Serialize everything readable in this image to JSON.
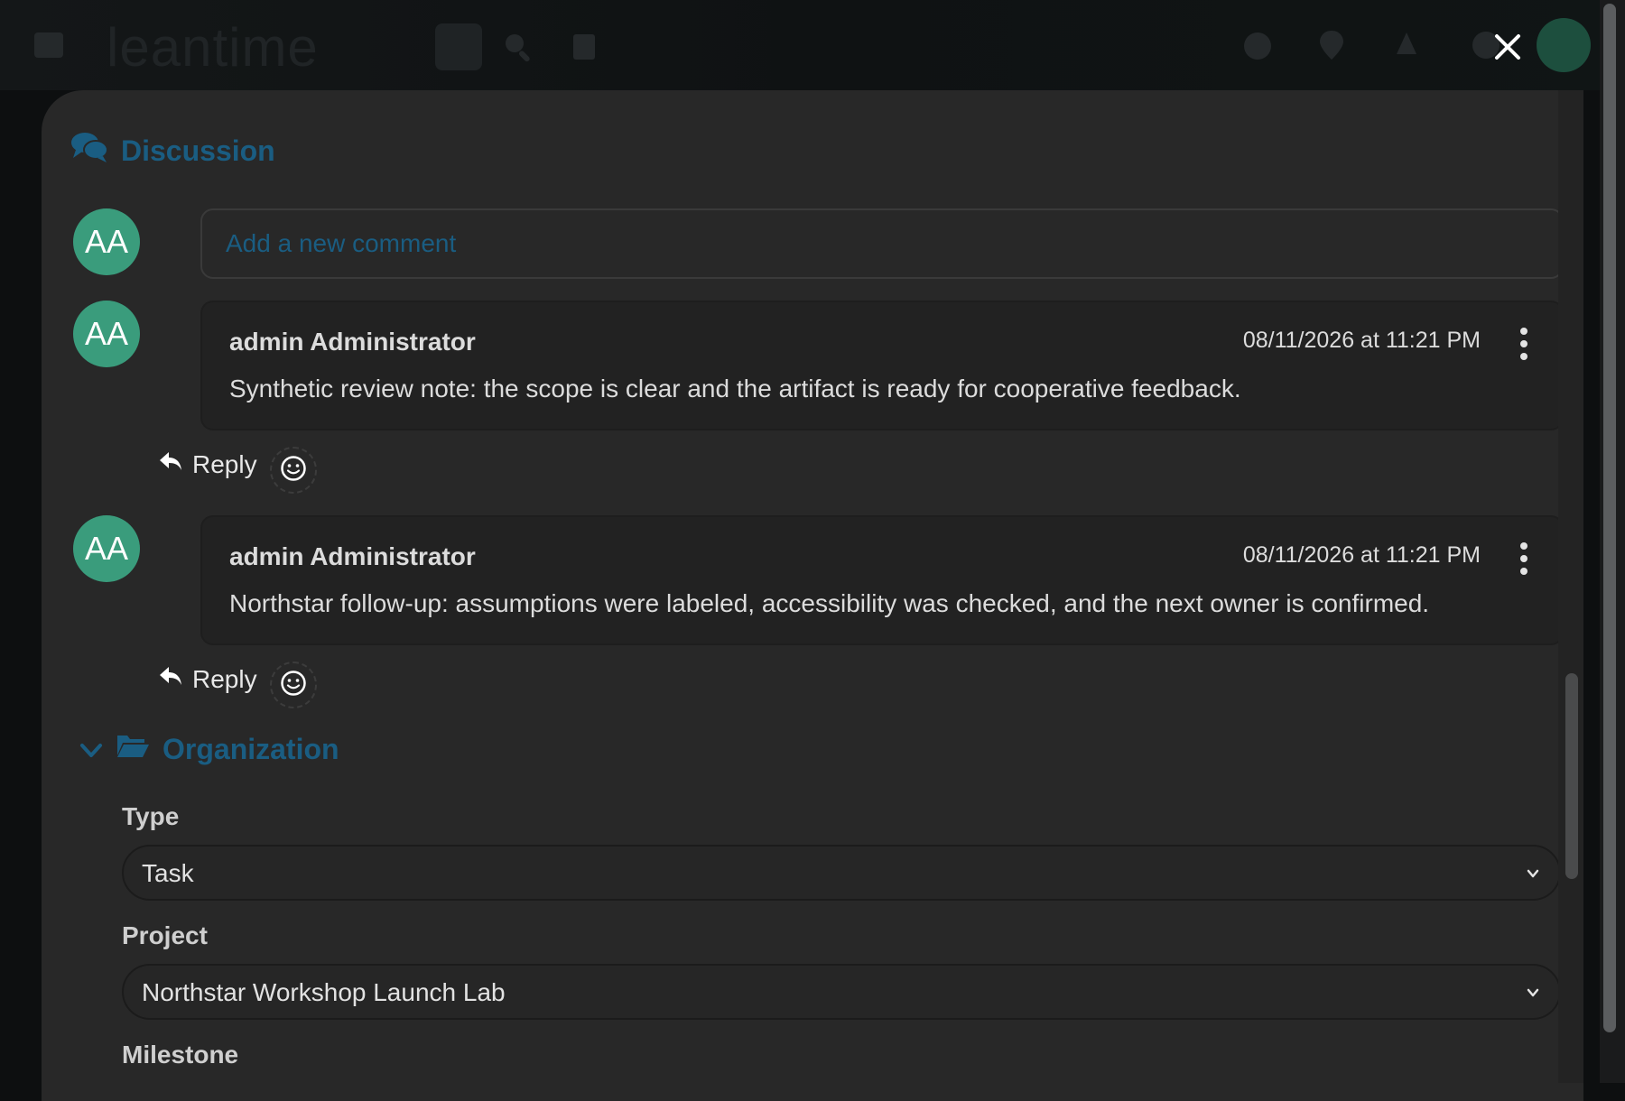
{
  "header": {
    "logo_text": "leantime",
    "icons": [
      "menu-icon",
      "search-icon",
      "trash-icon",
      "play-icon",
      "pin-icon",
      "notification-icon",
      "settings-icon"
    ],
    "close_icon": "close-icon"
  },
  "discussion": {
    "title": "Discussion",
    "new_comment_placeholder": "Add a new comment",
    "user_initials": "AA",
    "comments": [
      {
        "initials": "AA",
        "author": "admin Administrator",
        "date": "08/11/2026 at 11:21 PM",
        "text": "Synthetic review note: the scope is clear and the artifact is ready for cooperative feedback.",
        "reply_label": "Reply"
      },
      {
        "initials": "AA",
        "author": "admin Administrator",
        "date": "08/11/2026 at 11:21 PM",
        "text": "Northstar follow-up: assumptions were labeled, accessibility was checked, and the next owner is confirmed.",
        "reply_label": "Reply"
      }
    ]
  },
  "organization": {
    "title": "Organization",
    "fields": {
      "type": {
        "label": "Type",
        "value": "Task"
      },
      "project": {
        "label": "Project",
        "value": "Northstar Workshop Launch Lab"
      },
      "milestone": {
        "label": "Milestone"
      }
    }
  },
  "colors": {
    "accent": "#1a5d82",
    "avatar": "#3a9c7c",
    "modal_bg": "#282828",
    "comment_bg": "#222222"
  }
}
